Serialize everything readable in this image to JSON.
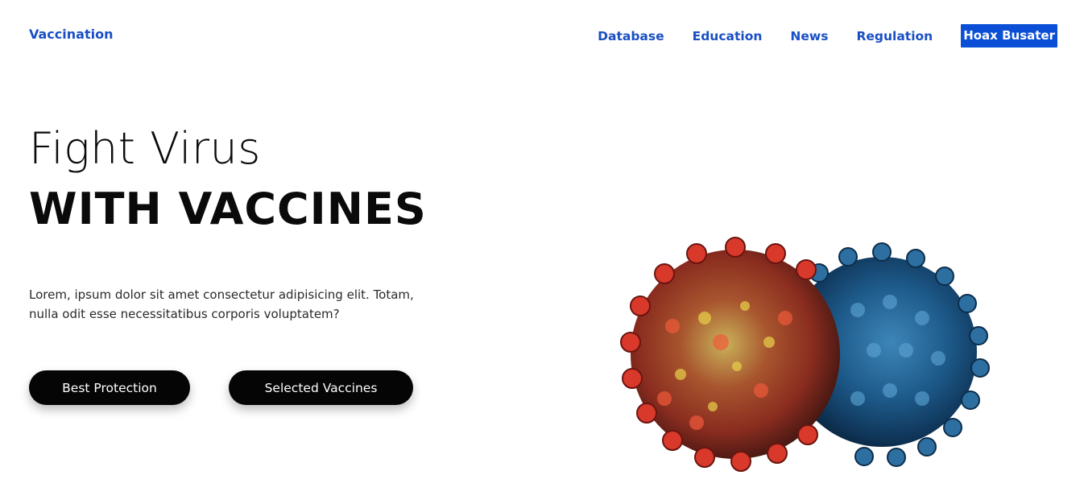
{
  "header": {
    "logo": "Vaccination",
    "nav": [
      {
        "label": "Database"
      },
      {
        "label": "Education"
      },
      {
        "label": "News"
      },
      {
        "label": "Regulation"
      },
      {
        "label": "Hoax Busater"
      }
    ]
  },
  "hero": {
    "title_line1": "Fight Virus",
    "title_line2": "WITH VACCINES",
    "description": "Lorem, ipsum dolor sit amet consectetur adipisicing elit. Totam, nulla odit esse necessitatibus corporis voluptatem?",
    "buttons": [
      {
        "label": "Best Protection"
      },
      {
        "label": "Selected Vaccines"
      }
    ]
  },
  "illustration": {
    "icon_left": "red-coronavirus-icon",
    "icon_right": "blue-coronavirus-icon"
  },
  "colors": {
    "accent": "#1a4fc4",
    "cta_bg": "#0a4fd6",
    "button_bg": "#050505"
  }
}
